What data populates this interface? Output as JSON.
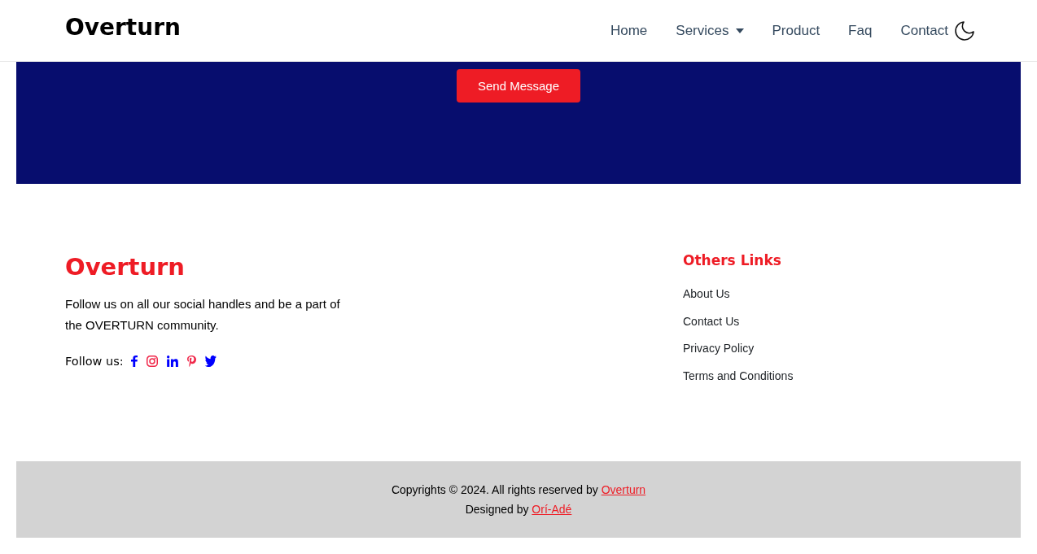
{
  "header": {
    "logo": "Overturn",
    "nav": [
      {
        "label": "Home",
        "kind": "link"
      },
      {
        "label": "Services",
        "kind": "dropdown"
      },
      {
        "label": "Product",
        "kind": "link"
      },
      {
        "label": "Faq",
        "kind": "link"
      },
      {
        "label": "Contact",
        "kind": "link"
      }
    ]
  },
  "contact_band": {
    "button": "Send Message"
  },
  "footer": {
    "brand": {
      "logo": "Overturn",
      "text": "Follow us on all our social handles and be a part of the OVERTURN community.",
      "follow_label": "Follow us:",
      "socials": [
        {
          "kind": "facebook",
          "color": "#0000ff"
        },
        {
          "kind": "instagram",
          "color": "#f0284a"
        },
        {
          "kind": "linkedin",
          "color": "#0000ff"
        },
        {
          "kind": "pinterest",
          "color": "#f0284a"
        },
        {
          "kind": "twitter",
          "color": "#0000ff"
        }
      ]
    },
    "links": {
      "title": "Others Links",
      "items": [
        "About Us",
        "Contact Us",
        "Privacy Policy",
        "Terms and Conditions"
      ]
    }
  },
  "bottom_bar": {
    "copyright": {
      "text": "Copyrights © 2024. All rights reserved by",
      "link": "Overturn"
    },
    "credit": {
      "text": "Designed by",
      "link": "Orí-Adé"
    }
  }
}
